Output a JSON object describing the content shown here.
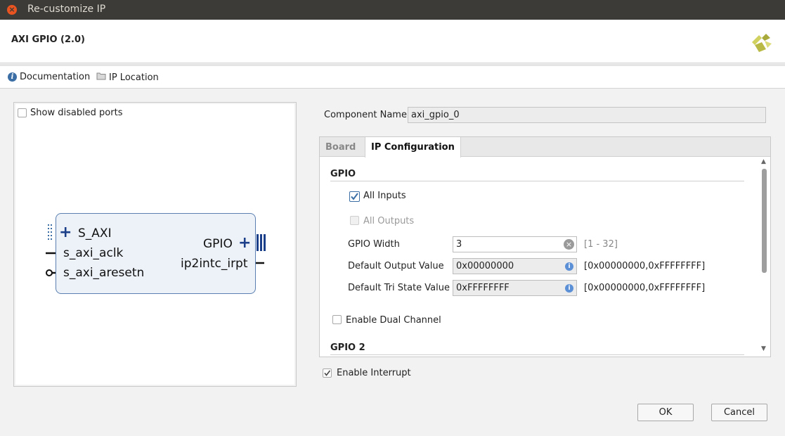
{
  "window": {
    "title": "Re-customize IP"
  },
  "header": {
    "title": "AXI GPIO (2.0)"
  },
  "toolbar": {
    "documentation": "Documentation",
    "ip_location": "IP Location"
  },
  "left_panel": {
    "show_disabled_ports": "Show disabled ports",
    "show_disabled_ports_checked": false,
    "block": {
      "ports_left": [
        "S_AXI",
        "s_axi_aclk",
        "s_axi_aresetn"
      ],
      "ports_right": [
        "GPIO",
        "ip2intc_irpt"
      ]
    }
  },
  "component": {
    "label": "Component Name",
    "value": "axi_gpio_0"
  },
  "tabs": [
    {
      "label": "Board",
      "active": false
    },
    {
      "label": "IP Configuration",
      "active": true
    }
  ],
  "gpio": {
    "section": "GPIO",
    "all_inputs": {
      "label": "All Inputs",
      "checked": true
    },
    "all_outputs": {
      "label": "All Outputs",
      "checked": false,
      "disabled": true
    },
    "width": {
      "label": "GPIO Width",
      "value": "3",
      "range": "[1 - 32]"
    },
    "default_output": {
      "label": "Default Output Value",
      "value": "0x00000000",
      "range": "[0x00000000,0xFFFFFFFF]"
    },
    "default_tri": {
      "label": "Default Tri State Value",
      "value": "0xFFFFFFFF",
      "range": "[0x00000000,0xFFFFFFFF]"
    },
    "dual_channel": {
      "label": "Enable Dual Channel",
      "checked": false
    }
  },
  "gpio2": {
    "section": "GPIO 2"
  },
  "enable_interrupt": {
    "label": "Enable Interrupt",
    "checked": true
  },
  "buttons": {
    "ok": "OK",
    "cancel": "Cancel"
  },
  "colors": {
    "accent": "#3a6ea5",
    "block_fill": "#edf2f9",
    "block_border": "#5a7fb0",
    "logo": "#c8c96a"
  }
}
